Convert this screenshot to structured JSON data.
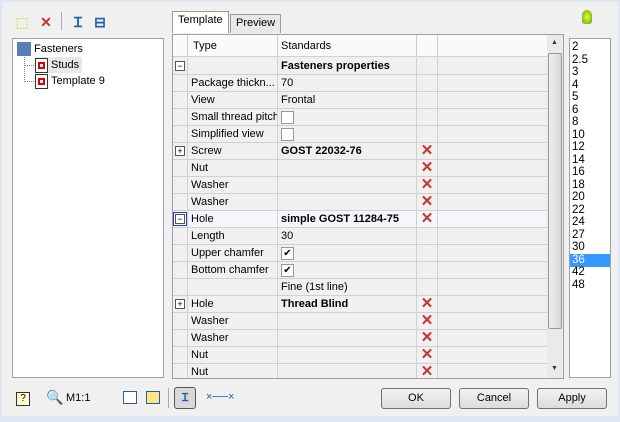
{
  "toolbar": {
    "icons": [
      "new-template-icon",
      "delete-icon",
      "insert-fastener-icon",
      "insert-hole-icon"
    ],
    "status_icon": "green-lightbulb-icon"
  },
  "tree": {
    "root": "Fasteners",
    "items": [
      "Studs",
      "Template 9"
    ],
    "selected": "Studs"
  },
  "tabs": [
    "Template",
    "Preview"
  ],
  "grid": {
    "headers": [
      "Type",
      "Standards"
    ],
    "rows": [
      {
        "exp": "-",
        "type": "",
        "value": "Fasteners properties",
        "bold": true
      },
      {
        "type": "Package thickn...",
        "value": "70"
      },
      {
        "type": "View",
        "value": "Frontal"
      },
      {
        "type": "Small thread pitch",
        "check": false
      },
      {
        "type": "Simplified view",
        "check": false
      },
      {
        "exp": "+",
        "type": "Screw",
        "value": "GOST 22032-76",
        "bold": true,
        "del": true
      },
      {
        "type": "Nut",
        "value": "",
        "del": true
      },
      {
        "type": "Washer",
        "value": "",
        "del": true
      },
      {
        "type": "Washer",
        "value": "",
        "del": true
      },
      {
        "exp": "-",
        "type": "Hole",
        "value": "simple GOST 11284-75",
        "bold": true,
        "del": true
      },
      {
        "type": "Length",
        "value": "30"
      },
      {
        "type": "Upper chamfer",
        "check": true
      },
      {
        "type": "Bottom chamfer",
        "check": true
      },
      {
        "type": "",
        "value": "Fine (1st line)"
      },
      {
        "exp": "+",
        "type": "Hole",
        "value": "Thread Blind",
        "bold": true,
        "del": true
      },
      {
        "type": "Washer",
        "value": "",
        "del": true
      },
      {
        "type": "Washer",
        "value": "",
        "del": true
      },
      {
        "type": "Nut",
        "value": "",
        "del": true
      },
      {
        "type": "Nut",
        "value": "",
        "del": true
      }
    ]
  },
  "diameters": {
    "items": [
      "2",
      "2.5",
      "3",
      "4",
      "5",
      "6",
      "8",
      "10",
      "12",
      "14",
      "16",
      "18",
      "20",
      "22",
      "24",
      "27",
      "30",
      "36",
      "42",
      "48"
    ],
    "selected": "36"
  },
  "bottom": {
    "scale": "M1:1"
  },
  "buttons": {
    "ok": "OK",
    "cancel": "Cancel",
    "apply": "Apply"
  },
  "colors": {
    "selection": "#3399ff",
    "delete": "#c83232"
  }
}
